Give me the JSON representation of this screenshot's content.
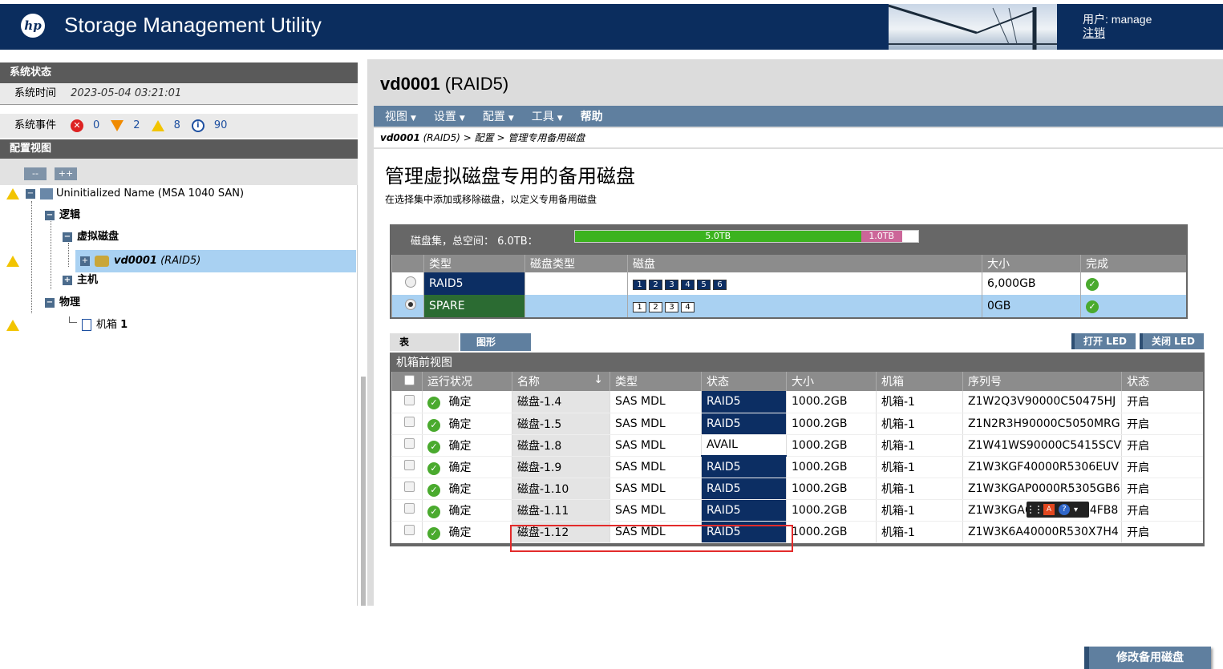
{
  "header": {
    "logo_text": "hp",
    "app_title": "Storage Management Utility",
    "user_label": "用户: manage",
    "logout_label": "注销"
  },
  "left": {
    "system_status_title": "系统状态",
    "system_time_label": "系统时间",
    "system_time_value": "2023-05-04 03:21:01",
    "system_events_label": "系统事件",
    "events": {
      "critical": "0",
      "error": "2",
      "warning": "8",
      "info": "90"
    },
    "config_view_title": "配置视图",
    "collapse_label": "--",
    "expand_label": "++",
    "tree": {
      "root": "Uninitialized Name (MSA 1040 SAN)",
      "logical": "逻辑",
      "vdisks": "虚拟磁盘",
      "vdisk_name": "vd0001",
      "vdisk_raid": "(RAID5)",
      "hosts": "主机",
      "physical": "物理",
      "enclosure": "机箱",
      "enclosure_num": "1"
    }
  },
  "right": {
    "title_bold": "vd0001",
    "title_rest": " (RAID5)",
    "menu": [
      {
        "label": "视图",
        "caret": "▼"
      },
      {
        "label": "设置",
        "caret": "▼"
      },
      {
        "label": "配置",
        "caret": "▼"
      },
      {
        "label": "工具",
        "caret": "▼"
      },
      {
        "label": "帮助",
        "caret": ""
      }
    ],
    "breadcrumb": {
      "vd": "vd0001",
      "rest": " (RAID5) > 配置 > 管理专用备用磁盘"
    },
    "page_heading": "管理虚拟磁盘专用的备用磁盘",
    "page_sub": "在选择集中添加或移除磁盘，以定义专用备用磁盘",
    "diskset": {
      "label": "磁盘集，总空间：  6.0TB：",
      "used_label": "5.0TB",
      "free_label": "1.0TB",
      "used_fraction": 0.833,
      "columns": [
        "",
        "类型",
        "磁盘类型",
        "磁盘",
        "大小",
        "完成"
      ],
      "rows": [
        {
          "selected": false,
          "type": "RAID5",
          "disk_type": "",
          "disks": [
            "1",
            "2",
            "3",
            "4",
            "5",
            "6"
          ],
          "size": "6,000GB",
          "done": "✓"
        },
        {
          "selected": true,
          "type": "SPARE",
          "disk_type": "",
          "disks": [
            "1",
            "2",
            "3",
            "4"
          ],
          "size": "0GB",
          "done": "✓"
        }
      ]
    },
    "tabs": {
      "table": "表",
      "graph": "图形"
    },
    "led_on": "打开 LED",
    "led_off": "关闭 LED",
    "enclosure": {
      "title": "机箱前视图",
      "columns": [
        "",
        "运行状况",
        "名称",
        "类型",
        "状态",
        "大小",
        "机箱",
        "序列号",
        "状态"
      ],
      "sort_arrow": "↓",
      "rows": [
        {
          "health": "确定",
          "name": "磁盘-1.4",
          "type": "SAS MDL",
          "status": "RAID5",
          "size": "1000.2GB",
          "enclosure": "机箱-1",
          "serial": "Z1W2Q3V90000C50475HJ",
          "state": "开启"
        },
        {
          "health": "确定",
          "name": "磁盘-1.5",
          "type": "SAS MDL",
          "status": "RAID5",
          "size": "1000.2GB",
          "enclosure": "机箱-1",
          "serial": "Z1N2R3H90000C5050MRG",
          "state": "开启"
        },
        {
          "health": "确定",
          "name": "磁盘-1.8",
          "type": "SAS MDL",
          "status": "AVAIL",
          "size": "1000.2GB",
          "enclosure": "机箱-1",
          "serial": "Z1W41WS90000C5415SCV",
          "state": "开启"
        },
        {
          "health": "确定",
          "name": "磁盘-1.9",
          "type": "SAS MDL",
          "status": "RAID5",
          "size": "1000.2GB",
          "enclosure": "机箱-1",
          "serial": "Z1W3KGF40000R5306EUV",
          "state": "开启"
        },
        {
          "health": "确定",
          "name": "磁盘-1.10",
          "type": "SAS MDL",
          "status": "RAID5",
          "size": "1000.2GB",
          "enclosure": "机箱-1",
          "serial": "Z1W3KGAP0000R5305GB6",
          "state": "开启"
        },
        {
          "health": "确定",
          "name": "磁盘-1.11",
          "type": "SAS MDL",
          "status": "RAID5",
          "size": "1000.2GB",
          "enclosure": "机箱-1",
          "serial": "Z1W3KGA60000R5304FB8",
          "state": "开启"
        },
        {
          "health": "确定",
          "name": "磁盘-1.12",
          "type": "SAS MDL",
          "status": "RAID5",
          "size": "1000.2GB",
          "enclosure": "机箱-1",
          "serial": "Z1W3K6A40000R530X7H4",
          "state": "开启"
        }
      ]
    },
    "modify_button": "修改备用磁盘"
  },
  "colors": {
    "header_navy": "#0b2d5e",
    "menu_blue": "#5f7f9f",
    "raid_navy": "#0c2e63",
    "spare_green": "#2b6b32",
    "used_green": "#3cb31f",
    "free_pink": "#cc6699",
    "selected_row": "#a9d1f2",
    "highlight_red": "#e32b2b"
  }
}
